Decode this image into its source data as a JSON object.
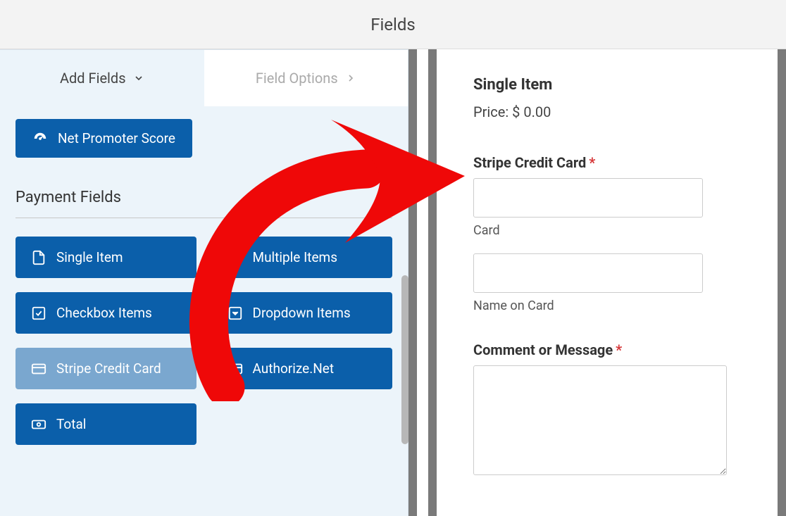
{
  "header": {
    "title": "Fields"
  },
  "tabs": {
    "add_fields": "Add Fields",
    "field_options": "Field Options"
  },
  "nps_button": {
    "label": "Net Promoter Score"
  },
  "section": {
    "title": "Payment Fields"
  },
  "fields": {
    "single_item": "Single Item",
    "multiple_items": "Multiple Items",
    "checkbox_items": "Checkbox Items",
    "dropdown_items": "Dropdown Items",
    "stripe_cc": "Stripe Credit Card",
    "authorize_net": "Authorize.Net",
    "total": "Total"
  },
  "preview": {
    "single_item_title": "Single Item",
    "price_label": "Price: $ 0.00",
    "stripe_label": "Stripe Credit Card",
    "card_sub": "Card",
    "name_on_card_sub": "Name on Card",
    "comment_label": "Comment or Message"
  }
}
